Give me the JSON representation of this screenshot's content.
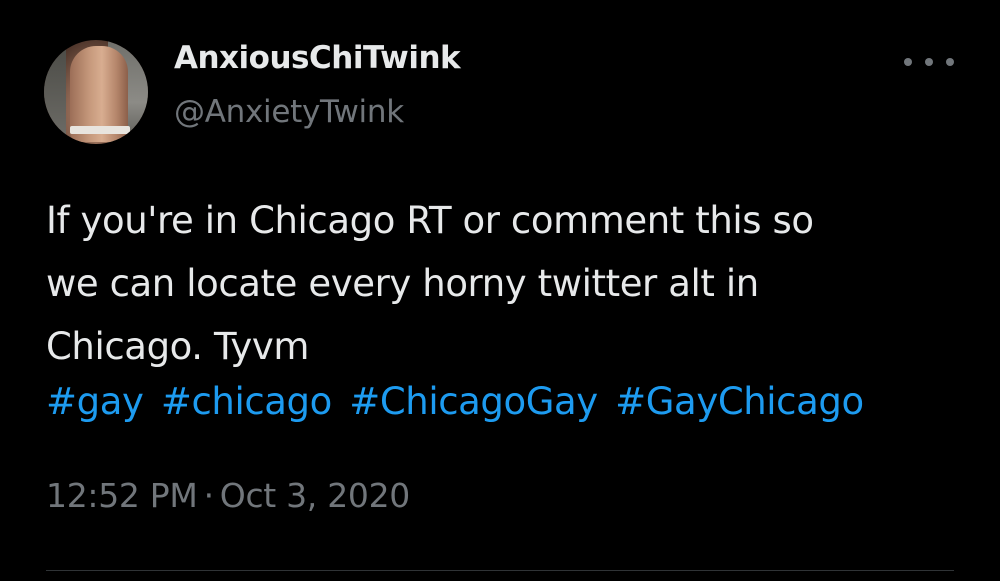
{
  "author": {
    "display_name": "AnxiousChiTwink",
    "handle": "@AnxietyTwink"
  },
  "tweet": {
    "lines": [
      "If you're in Chicago RT or comment this so",
      "we can locate every horny twitter alt in",
      "Chicago. Tyvm"
    ],
    "hashtags": [
      "#gay",
      "#chicago",
      "#ChicagoGay",
      "#GayChicago"
    ],
    "time": "12:52 PM",
    "separator": "·",
    "date": "Oct 3, 2020"
  },
  "icons": {
    "more": "more-horizontal-icon",
    "avatar": "profile-photo"
  },
  "colors": {
    "background": "#000000",
    "text_primary": "#e7e9ea",
    "text_secondary": "#71767b",
    "link": "#1d9bf0",
    "divider": "#2f3336"
  }
}
